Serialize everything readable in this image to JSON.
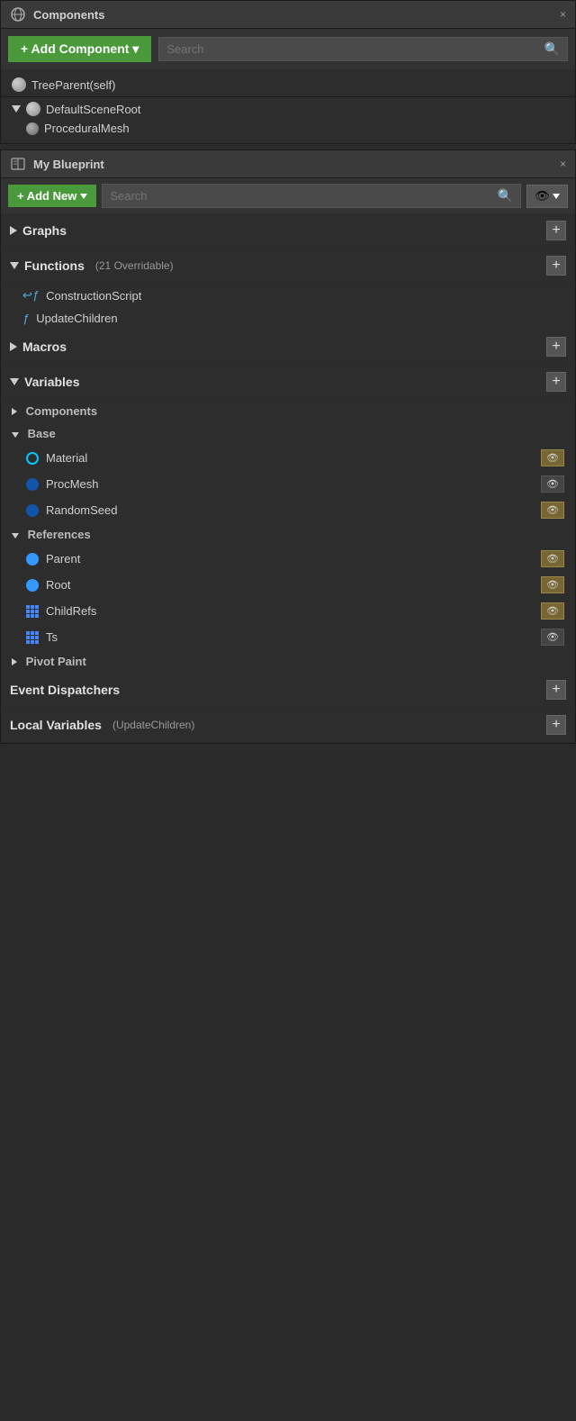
{
  "components_panel": {
    "title": "Components",
    "add_button": "+ Add Component ▾",
    "search_placeholder": "Search",
    "tree": [
      {
        "label": "TreeParent(self)",
        "type": "sphere",
        "indent": 0
      },
      {
        "label": "DefaultSceneRoot",
        "type": "sphere-collapsed",
        "indent": 0
      },
      {
        "label": "ProceduralMesh",
        "type": "sphere-small",
        "indent": 1
      }
    ]
  },
  "blueprint_panel": {
    "title": "My Blueprint",
    "add_button": "+ Add New",
    "search_placeholder": "Search",
    "sections": [
      {
        "label": "Graphs",
        "expanded": false,
        "has_plus": true,
        "items": []
      },
      {
        "label": "Functions",
        "sublabel": "(21 Overridable)",
        "expanded": true,
        "has_plus": true,
        "items": [
          {
            "label": "ConstructionScript",
            "type": "construction"
          },
          {
            "label": "UpdateChildren",
            "type": "function"
          }
        ]
      },
      {
        "label": "Macros",
        "expanded": false,
        "has_plus": true,
        "items": []
      },
      {
        "label": "Variables",
        "expanded": true,
        "has_plus": true,
        "items": []
      }
    ],
    "variable_groups": [
      {
        "name": "Components",
        "vars": []
      },
      {
        "name": "Base",
        "vars": [
          {
            "label": "Material",
            "dot_type": "cyan-ring",
            "eye": "yellow",
            "eye_visible": true
          },
          {
            "label": "ProcMesh",
            "dot_type": "dark-blue",
            "eye": "gray",
            "eye_visible": true
          },
          {
            "label": "RandomSeed",
            "dot_type": "dark-blue",
            "eye": "yellow",
            "eye_visible": true
          }
        ]
      },
      {
        "name": "References",
        "vars": [
          {
            "label": "Parent",
            "dot_type": "blue-fill",
            "eye": "yellow",
            "eye_visible": true
          },
          {
            "label": "Root",
            "dot_type": "blue-fill",
            "eye": "yellow",
            "eye_visible": true
          },
          {
            "label": "ChildRefs",
            "dot_type": "grid-blue",
            "eye": "yellow",
            "eye_visible": true
          },
          {
            "label": "Ts",
            "dot_type": "grid-blue",
            "eye": "gray",
            "eye_visible": true
          }
        ]
      },
      {
        "name": "Pivot Paint",
        "vars": []
      }
    ],
    "bottom_sections": [
      {
        "label": "Event Dispatchers",
        "has_plus": true
      },
      {
        "label": "Local Variables",
        "sublabel": "(UpdateChildren)",
        "has_plus": true
      }
    ]
  },
  "icons": {
    "search": "🔍",
    "eye": "👁",
    "close": "×",
    "construction_script": "↩ƒ",
    "function": "ƒ"
  }
}
